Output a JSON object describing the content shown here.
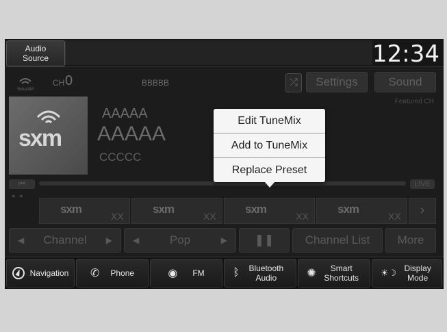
{
  "header": {
    "audio_source": "Audio Source",
    "clock": "12:34"
  },
  "tuner": {
    "ch_label": "CH",
    "channel": "0",
    "name_small": "BBBBB",
    "settings_label": "Settings",
    "sound_label": "Sound",
    "featured_label": "Featured CH",
    "shuffle_icon": "shuffle-icon"
  },
  "now_playing": {
    "line1": "AAAAA",
    "line2": "AAAAA",
    "line3": "CCCCC",
    "art_logo": "sxm"
  },
  "progress": {
    "live_label": "LIVE",
    "seek_icon": "skip-back-icon"
  },
  "presets": [
    {
      "logo": "sxm",
      "num": "XX"
    },
    {
      "logo": "sxm",
      "num": "XX"
    },
    {
      "logo": "sxm",
      "num": "XX"
    },
    {
      "logo": "sxm",
      "num": "XX"
    }
  ],
  "controls": {
    "channel_label": "Channel",
    "category_label": "Pop",
    "pause_icon": "pause-icon",
    "channel_list_label": "Channel List",
    "more_label": "More"
  },
  "popup": {
    "items": [
      "Edit TuneMix",
      "Add to TuneMix",
      "Replace Preset"
    ]
  },
  "bottom_nav": {
    "navigation": "Navigation",
    "phone": "Phone",
    "fm": "FM",
    "bluetooth": "Bluetooth Audio",
    "smart": "Smart Shortcuts",
    "display": "Display Mode"
  },
  "colors": {
    "popup_bg": "#f5f5f5",
    "screen_bg": "#1c1c1c",
    "frame_bg": "#d4d4d4"
  }
}
